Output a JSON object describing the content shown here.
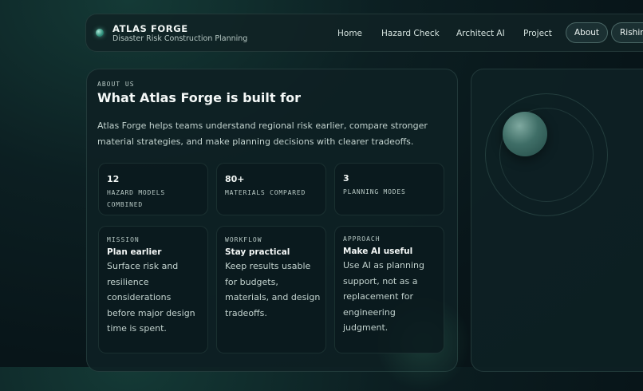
{
  "header": {
    "brand_title": "ATLAS FORGE",
    "brand_subtitle": "Disaster Risk Construction Planning",
    "nav": [
      "Home",
      "Hazard Check",
      "Architect AI",
      "Project",
      "About",
      "Rishir"
    ]
  },
  "about": {
    "eyebrow": "ABOUT US",
    "title": "What Atlas Forge is built for",
    "lead": "Atlas Forge helps teams understand regional risk earlier, compare stronger material strategies, and make planning decisions with clearer tradeoffs.",
    "stats": [
      {
        "value": "12",
        "label": "HAZARD MODELS COMBINED"
      },
      {
        "value": "80+",
        "label": "MATERIALS COMPARED"
      },
      {
        "value": "3",
        "label": "PLANNING MODES"
      }
    ],
    "tiles": [
      {
        "eyebrow": "MISSION",
        "title": "Plan earlier",
        "body": "Surface risk and resilience considerations before major design time is spent."
      },
      {
        "eyebrow": "WORKFLOW",
        "title": "Stay practical",
        "body": "Keep results usable for budgets, materials, and design tradeoffs."
      },
      {
        "eyebrow": "APPROACH",
        "title": "Make AI useful",
        "body": "Use AI as planning support, not as a replacement for engineering judgment."
      }
    ]
  },
  "colors": {
    "accent": "#2e8e7a",
    "background": "#081519",
    "card": "#0e2124"
  }
}
